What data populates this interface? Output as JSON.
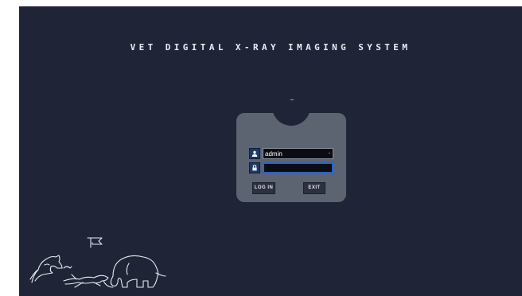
{
  "app": {
    "title": "VET DIGITAL X-RAY IMAGING SYSTEM"
  },
  "login": {
    "username_value": "admin",
    "password_value": "",
    "login_label": "LOG IN",
    "exit_label": "EXIT",
    "dropdown_caret": "⌄"
  },
  "icons": {
    "avatar": "user-outline-icon",
    "user_field": "user-icon",
    "password_field": "lock-icon",
    "logo": "animal-line-drawing-logo"
  },
  "colors": {
    "background": "#1f2536",
    "panel": "#5c6371",
    "field_icon_bg": "#1e3a66",
    "focus_border": "#2d62c8"
  }
}
